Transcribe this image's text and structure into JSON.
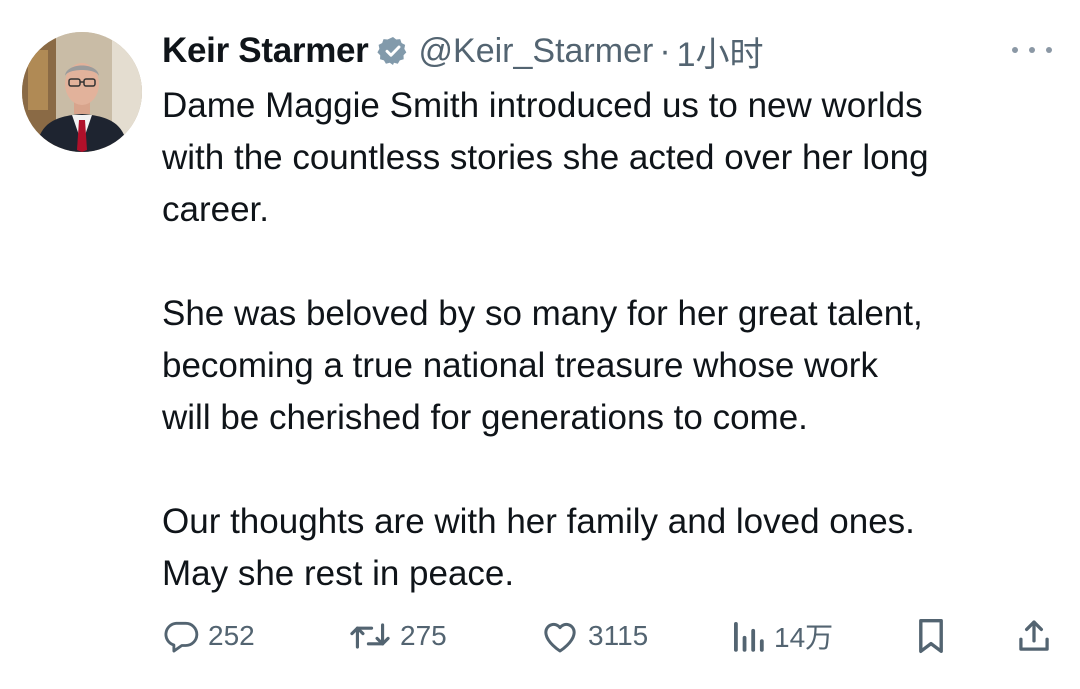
{
  "author": {
    "name": "Keir Starmer",
    "handle": "@Keir_Starmer",
    "separator": "·",
    "time": "1小时"
  },
  "tweet": {
    "paragraphs": [
      [
        "Dame Maggie Smith introduced us to new worlds",
        "with the countless stories she acted over her long",
        "career."
      ],
      [
        "She was beloved by so many for her great talent,",
        "becoming a true national treasure whose work",
        "will be cherished for generations to come."
      ],
      [
        "Our thoughts are with her family and loved ones.",
        "May she rest in peace."
      ]
    ]
  },
  "actions": {
    "replies": "252",
    "reposts": "275",
    "likes": "3115",
    "views": "14万"
  },
  "icons": {
    "verified": "verified-badge-icon",
    "more": "more-options-icon",
    "reply": "reply-icon",
    "repost": "repost-icon",
    "like": "heart-icon",
    "views": "analytics-icon",
    "bookmark": "bookmark-icon",
    "share": "share-icon"
  },
  "colors": {
    "text": "#0f1419",
    "secondary": "#536471",
    "verified_badge": "#829aab"
  }
}
